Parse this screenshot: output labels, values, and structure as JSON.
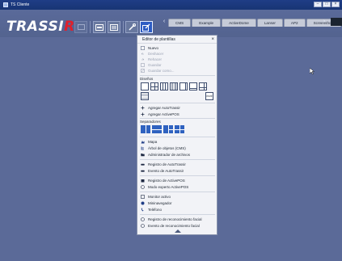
{
  "window": {
    "title": "TS Cliente"
  },
  "logo": {
    "text_main": "TRASSI",
    "text_accent": "R"
  },
  "tabs": [
    {
      "label": "CMS"
    },
    {
      "label": "Example"
    },
    {
      "label": "ActiveDome"
    },
    {
      "label": "Lanser"
    },
    {
      "label": "AP2"
    },
    {
      "label": "Screenshots"
    }
  ],
  "menu": {
    "title": "Editor de plantillas",
    "file_items": [
      {
        "label": "Nuevo",
        "icon": "new-file-icon",
        "enabled": true
      },
      {
        "label": "Deshacer",
        "icon": "undo-icon",
        "enabled": false
      },
      {
        "label": "Rehacer",
        "icon": "redo-icon",
        "enabled": false
      },
      {
        "label": "Guardar",
        "icon": "save-icon",
        "enabled": false
      },
      {
        "label": "Guardar como...",
        "icon": "save-as-icon",
        "enabled": false
      }
    ],
    "layouts_title": "Diseños",
    "more_label": "more",
    "auto_items": [
      {
        "label": "Agregar AutoTrassir",
        "icon": "add-icon"
      },
      {
        "label": "Agregar ActivePOS",
        "icon": "add-icon"
      }
    ],
    "separators_title": "Separadores",
    "tool_items": [
      {
        "label": "Mapa",
        "icon": "map-icon"
      },
      {
        "label": "Árbol de objetos (CMS)",
        "icon": "tree-icon"
      },
      {
        "label": "Administrador de archivos",
        "icon": "folder-icon"
      }
    ],
    "log_items": [
      {
        "label": "Registro de AutoTrassir",
        "icon": "car-icon"
      },
      {
        "label": "Evento de AutoTrassir",
        "icon": "car-event-icon"
      }
    ],
    "pos_items": [
      {
        "label": "Registro de ActivePOS",
        "icon": "register-icon"
      },
      {
        "label": "Modo experto ActivePOS",
        "icon": "expert-icon"
      }
    ],
    "monitor_items": [
      {
        "label": "Monitor activo",
        "icon": "monitor-icon"
      },
      {
        "label": "Mininavegador",
        "icon": "browser-icon"
      },
      {
        "label": "Teléfono",
        "icon": "phone-icon"
      }
    ],
    "face_items": [
      {
        "label": "Registro de reconocimiento facial",
        "icon": "face-log-icon"
      },
      {
        "label": "Evento de reconocimiento facial",
        "icon": "face-event-icon"
      }
    ]
  },
  "colors": {
    "accent": "#2f62c0",
    "logo_red": "#e0202c",
    "background": "#5b6a98"
  }
}
